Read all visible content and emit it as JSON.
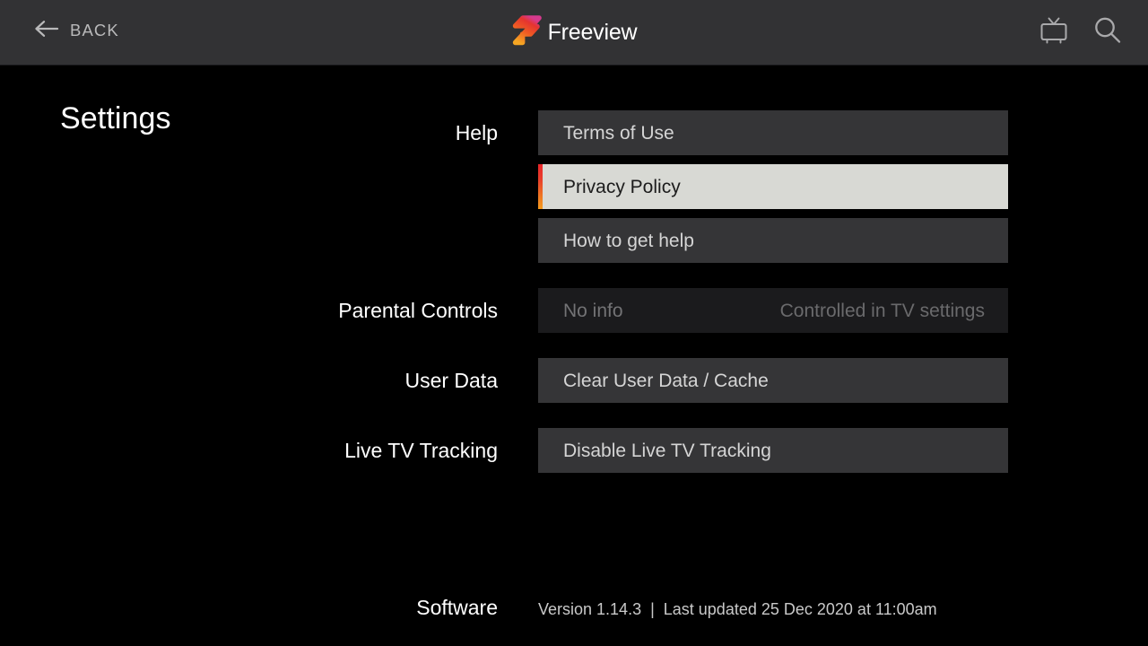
{
  "header": {
    "back_label": "BACK",
    "back_icon": "arrow-left-icon",
    "brand_name": "Freeview",
    "brand_mark_icon": "freeview-f-logo-icon",
    "tv_guide_icon": "tv-icon",
    "search_icon": "search-icon",
    "background_color": "#323234"
  },
  "page": {
    "title": "Settings",
    "background_color": "#000000"
  },
  "groups": [
    {
      "label": "Help",
      "rows": [
        {
          "text": "Terms of Use",
          "state": "normal",
          "aux": ""
        },
        {
          "text": "Privacy Policy",
          "state": "selected",
          "aux": ""
        },
        {
          "text": "How to get help",
          "state": "normal",
          "aux": ""
        }
      ]
    },
    {
      "label": "Parental Controls",
      "rows": [
        {
          "text": "No info",
          "state": "disabled",
          "aux": "Controlled in TV settings"
        }
      ]
    },
    {
      "label": "User Data",
      "rows": [
        {
          "text": "Clear User Data / Cache",
          "state": "normal",
          "aux": ""
        }
      ]
    },
    {
      "label": "Live TV Tracking",
      "rows": [
        {
          "text": "Disable Live TV Tracking",
          "state": "normal",
          "aux": ""
        }
      ]
    }
  ],
  "footer": {
    "label": "Software",
    "value": "Version 1.14.3  |  Last updated 25 Dec 2020 at 11:00am"
  },
  "colors": {
    "accent_top": "#e8252a",
    "accent_bottom": "#f59b1e",
    "row_background": "#353537",
    "row_selected_background": "#d8d9d4",
    "row_disabled_background": "#1b1b1d",
    "header_background": "#323234"
  }
}
